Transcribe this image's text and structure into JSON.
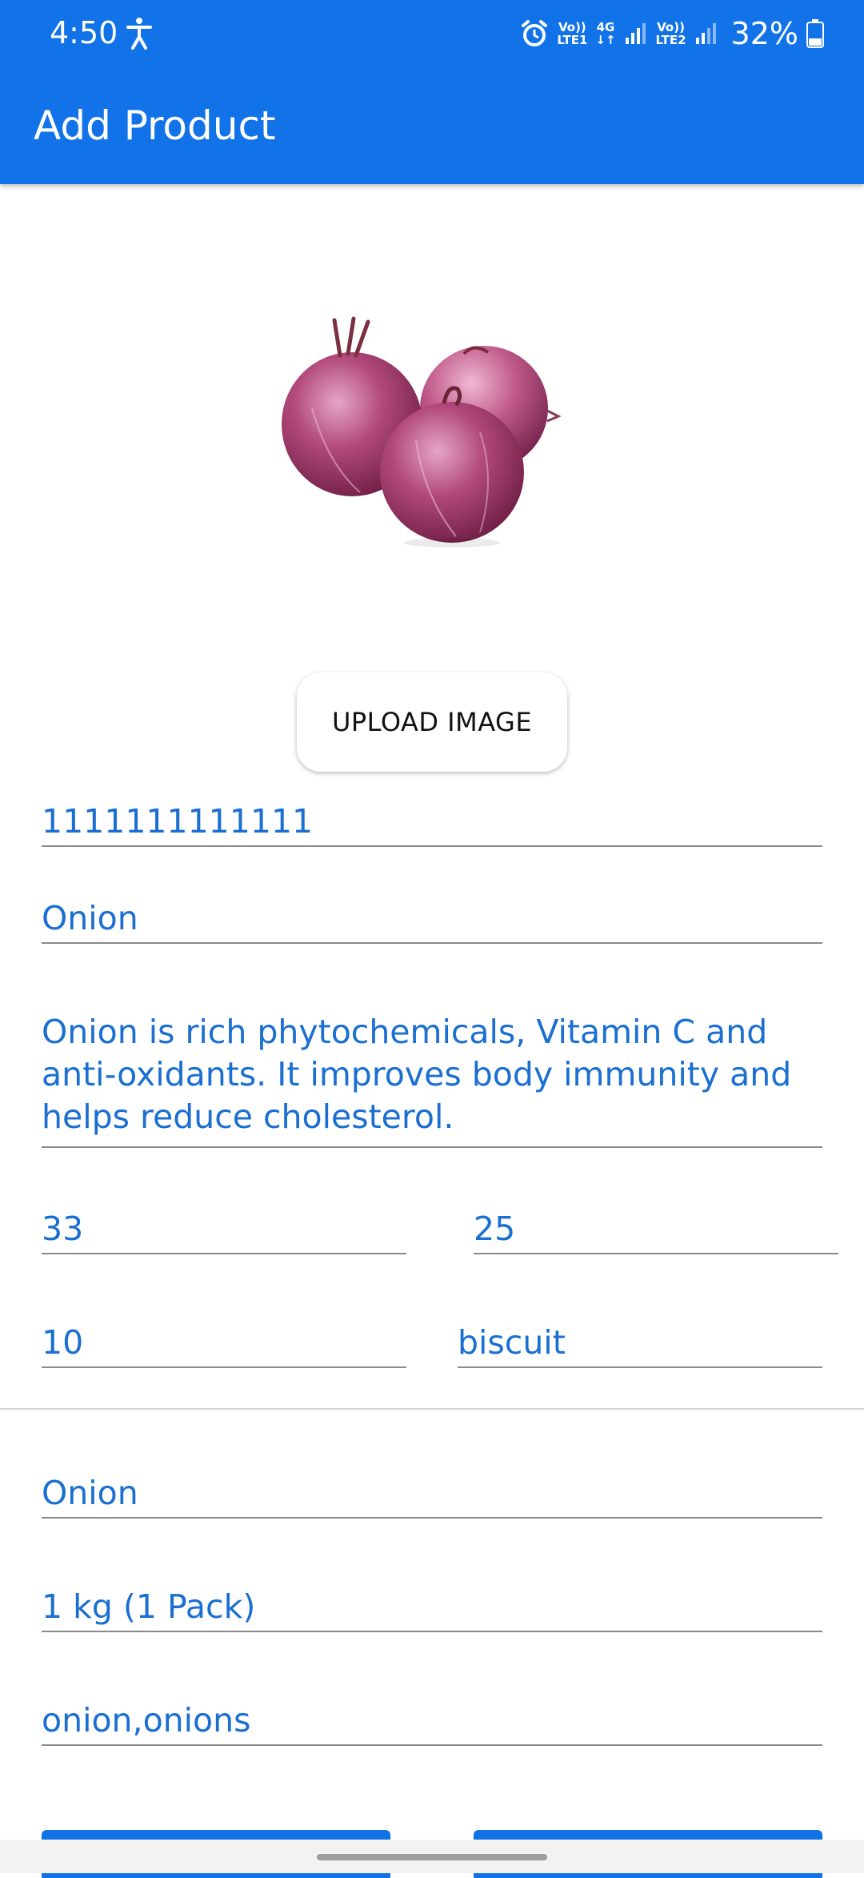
{
  "status_bar": {
    "time": "4:50",
    "sim1_top": "Vo))",
    "sim1_bottom": "LTE1",
    "network_type": "4G",
    "sim2_top": "Vo))",
    "sim2_bottom": "LTE2",
    "battery_percent": "32%",
    "icons": [
      "accessibility-icon",
      "alarm-icon",
      "signal-icon",
      "battery-icon"
    ]
  },
  "app_bar": {
    "title": "Add Product"
  },
  "product_image": {
    "alt": "Red onions"
  },
  "upload_button": {
    "label": "UPLOAD IMAGE"
  },
  "form": {
    "barcode": "1111111111111",
    "name": "Onion",
    "description": "Onion is rich phytochemicals, Vitamin C and anti-oxidants. It improves body immunity and helps reduce cholesterol.",
    "price_1": "33",
    "price_2": "25",
    "quantity": "10",
    "category": "biscuit",
    "subtitle": "Onion",
    "unit": "1 kg (1 Pack)",
    "tags": "onion,onions"
  },
  "colors": {
    "primary": "#1273e8",
    "field_text": "#1a6fd1",
    "underline": "#8a8a8a"
  }
}
